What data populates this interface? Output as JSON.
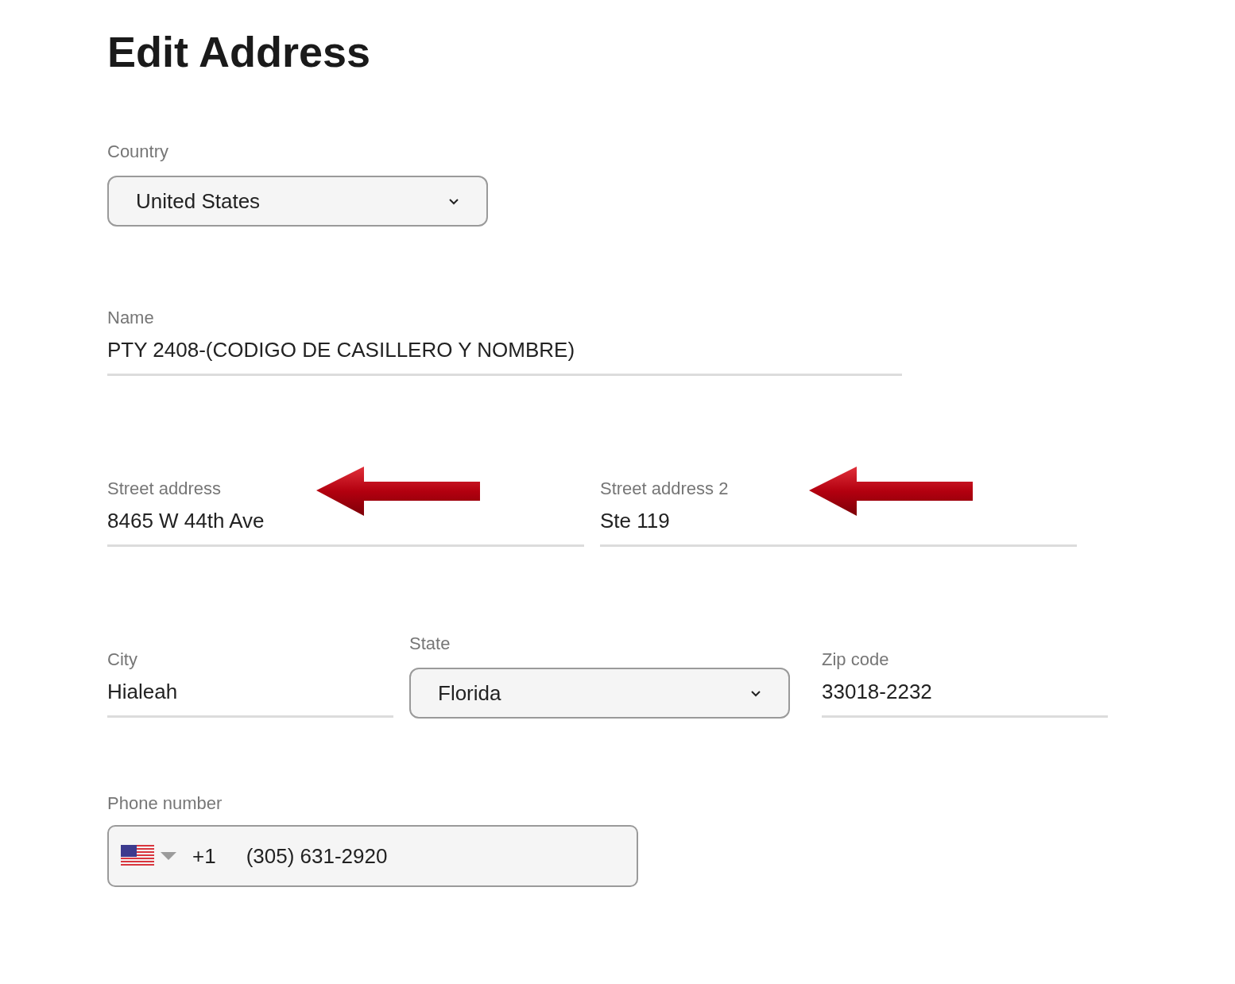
{
  "title": "Edit Address",
  "country": {
    "label": "Country",
    "value": "United States"
  },
  "name": {
    "label": "Name",
    "value": "PTY 2408-(CODIGO DE CASILLERO Y NOMBRE)"
  },
  "street_address": {
    "label": "Street address",
    "value": "8465 W 44th Ave"
  },
  "street_address_2": {
    "label": "Street address 2",
    "value": "Ste 119"
  },
  "city": {
    "label": "City",
    "value": "Hialeah"
  },
  "state": {
    "label": "State",
    "value": "Florida"
  },
  "zip_code": {
    "label": "Zip code",
    "value": "33018-2232"
  },
  "phone": {
    "label": "Phone number",
    "dial_code": "+1",
    "value": "(305) 631-2920"
  }
}
